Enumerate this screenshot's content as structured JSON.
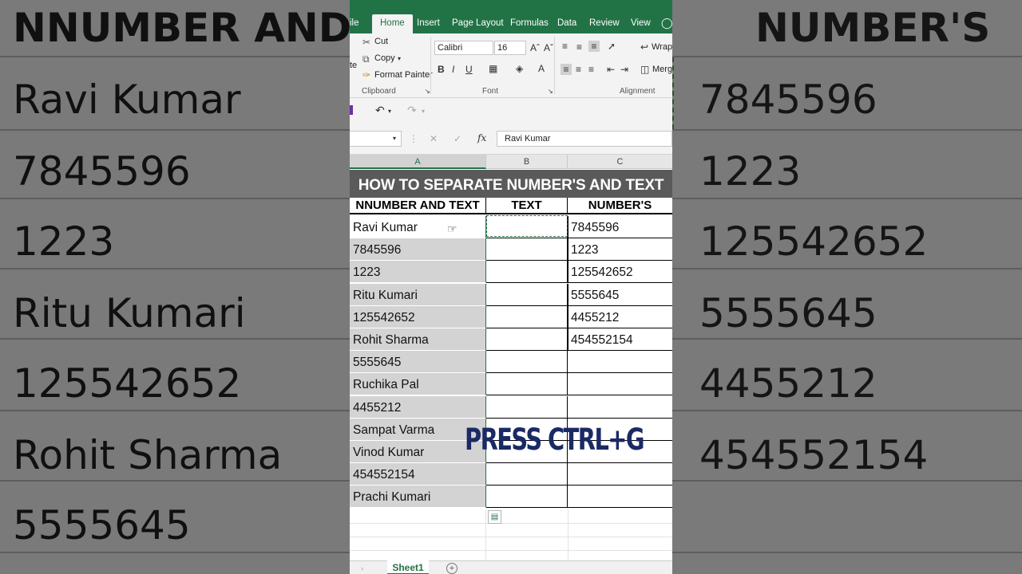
{
  "background": {
    "left_cells": [
      "NNUMBER AND T",
      "Ravi Kumar",
      "7845596",
      "1223",
      "Ritu Kumari",
      "125542652",
      "Rohit Sharma",
      "5555645"
    ],
    "right_cells": [
      "NUMBER'S",
      "7845596",
      "1223",
      "125542652",
      "5555645",
      "4455212",
      "454552154"
    ]
  },
  "ribbon": {
    "tabs": [
      "ile",
      "Home",
      "Insert",
      "Page Layout",
      "Formulas",
      "Data",
      "Review",
      "View"
    ],
    "active_tab": "Home",
    "clipboard": {
      "cut": "Cut",
      "copy": "Copy",
      "format_painter": "Format Painter",
      "paste_fragment": "te",
      "group": "Clipboard"
    },
    "font": {
      "name": "Calibri",
      "size": "16",
      "group": "Font",
      "bold": "B",
      "italic": "I",
      "underline": "U"
    },
    "alignment": {
      "wrap": "Wrap",
      "merge": "Merg",
      "group": "Alignment"
    }
  },
  "formula_bar": {
    "fx": "fx",
    "content": "Ravi Kumar"
  },
  "columns": [
    "A",
    "B",
    "C"
  ],
  "sheet": {
    "banner": "HOW TO SEPARATE NUMBER'S AND TEXT",
    "headers": [
      "NNUMBER AND TEXT",
      "TEXT",
      "NUMBER'S"
    ],
    "col_a": [
      "Ravi Kumar",
      "7845596",
      "1223",
      "Ritu Kumari",
      "125542652",
      "Rohit Sharma",
      "5555645",
      "Ruchika Pal",
      "4455212",
      "Sampat Varma",
      "Vinod Kumar",
      "454552154",
      "Prachi Kumari"
    ],
    "col_c": [
      "7845596",
      "1223",
      "125542652",
      "5555645",
      "4455212",
      "454552154",
      "",
      "",
      "",
      "",
      "",
      "",
      ""
    ]
  },
  "sheet_tab": "Sheet1",
  "overlay_text": "PRESS CTRL+G",
  "colors": {
    "excel_green": "#217346",
    "banner": "#5a5a5a",
    "selection": "#d3d3d3",
    "overlay": "#1a2a64"
  }
}
